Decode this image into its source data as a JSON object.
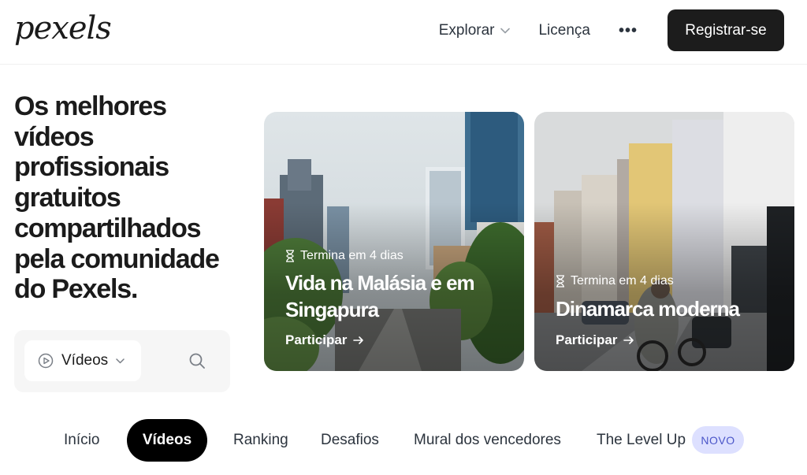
{
  "header": {
    "logo": "pexels",
    "nav": {
      "explore": "Explorar",
      "license": "Licença",
      "more": "•••",
      "register": "Registrar-se"
    }
  },
  "hero": {
    "title": "Os melhores vídeos profissionais gratuitos compartilhados pela comunidade do Pexels."
  },
  "search": {
    "type_selected": "Vídeos"
  },
  "challenges": [
    {
      "ends": "Termina em 4 dias",
      "title": "Vida na Malásia e em Singapura",
      "cta": "Participar"
    },
    {
      "ends": "Termina em 4 dias",
      "title": "Dinamarca moderna",
      "cta": "Participar"
    }
  ],
  "tabs": {
    "home": "Início",
    "videos": "Vídeos",
    "ranking": "Ranking",
    "challenges": "Desafios",
    "winners": "Mural dos vencedores",
    "level_up": "The Level Up",
    "new_badge": "NOVO"
  },
  "colors": {
    "accent_dark": "#1c1c1c",
    "badge_bg": "#dde0ff",
    "badge_text": "#4a55c8"
  }
}
